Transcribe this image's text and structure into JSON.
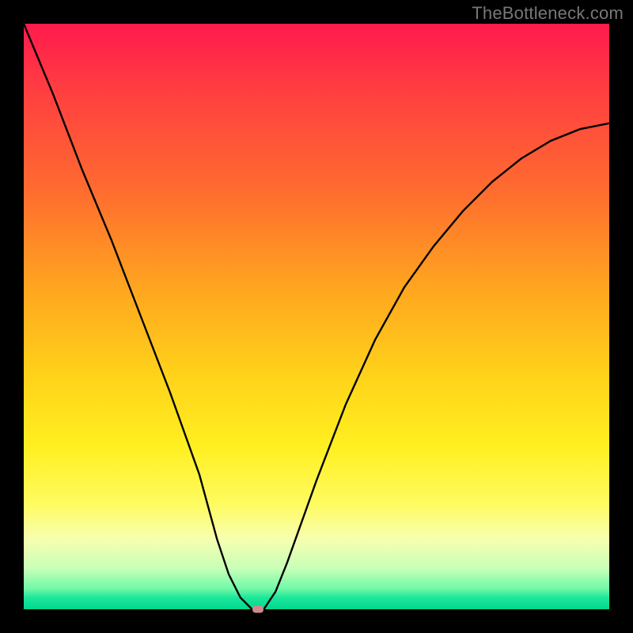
{
  "attribution": "TheBottleneck.com",
  "colors": {
    "frame": "#000000",
    "marker": "#d0888c",
    "curve_stroke": "#000000"
  },
  "chart_data": {
    "type": "line",
    "title": "",
    "xlabel": "",
    "ylabel": "",
    "xlim": [
      0,
      100
    ],
    "ylim": [
      0,
      100
    ],
    "x": [
      0,
      5,
      10,
      15,
      20,
      25,
      30,
      33,
      35,
      37,
      39,
      40,
      41,
      43,
      45,
      50,
      55,
      60,
      65,
      70,
      75,
      80,
      85,
      90,
      95,
      100
    ],
    "values": [
      100,
      88,
      75,
      63,
      50,
      37,
      23,
      12,
      6,
      2,
      0,
      0,
      0,
      3,
      8,
      22,
      35,
      46,
      55,
      62,
      68,
      73,
      77,
      80,
      82,
      83
    ],
    "marker": {
      "x": 40,
      "y": 0
    },
    "gradient_stops": [
      {
        "pos": 0.0,
        "color": "#ff1a4d"
      },
      {
        "pos": 0.28,
        "color": "#ff6a30"
      },
      {
        "pos": 0.6,
        "color": "#ffd21a"
      },
      {
        "pos": 0.88,
        "color": "#f7ffb0"
      },
      {
        "pos": 1.0,
        "color": "#00d890"
      }
    ]
  }
}
